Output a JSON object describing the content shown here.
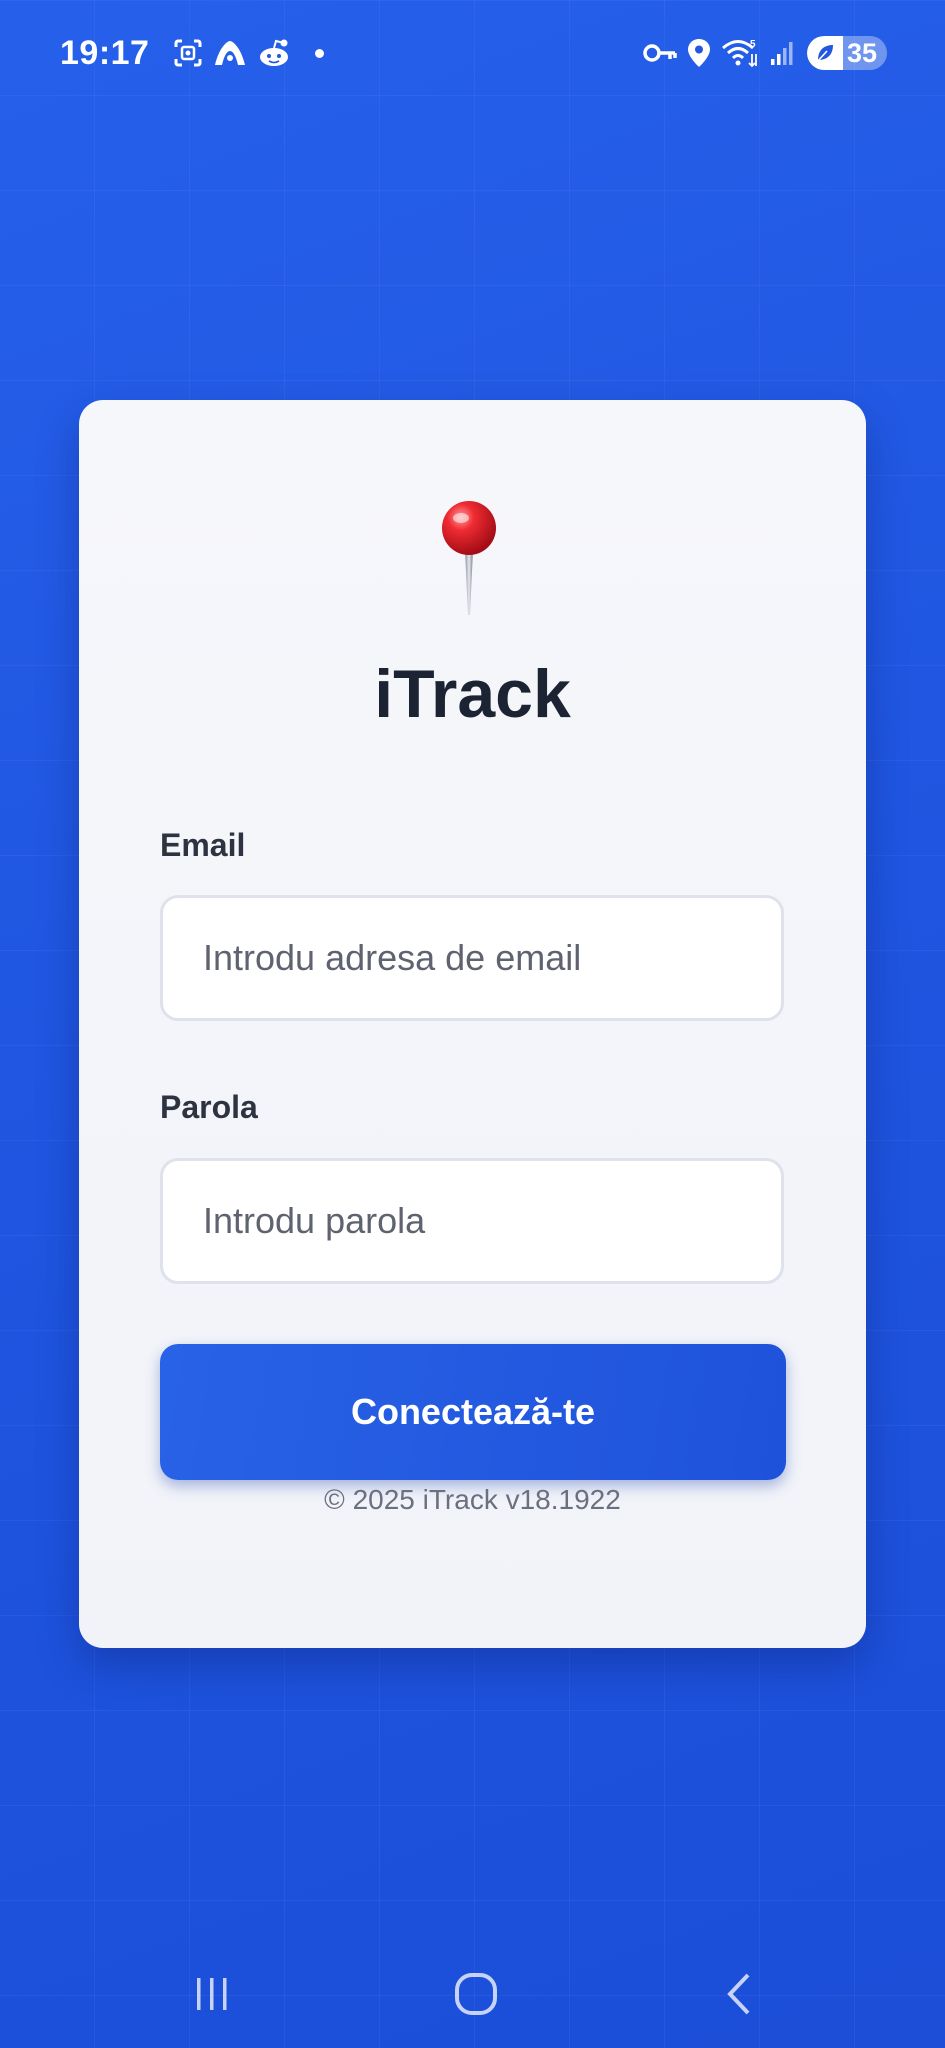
{
  "status_bar": {
    "time": "19:17",
    "battery_level": "35",
    "left_icons": [
      "screenshot-icon",
      "bird-app-icon",
      "reddit-icon",
      "notification-dot"
    ],
    "right_icons": [
      "vpn-key-icon",
      "location-icon",
      "wifi-icon",
      "signal-icon",
      "battery-icon"
    ]
  },
  "login": {
    "logo_icon": "pushpin-icon",
    "title": "iTrack",
    "email_label": "Email",
    "email_placeholder": "Introdu adresa de email",
    "email_value": "",
    "password_label": "Parola",
    "password_placeholder": "Introdu parola",
    "password_value": "",
    "submit_label": "Conectează-te",
    "footer": "© 2025 iTrack v18.1922"
  },
  "navigation": {
    "buttons": [
      "recent-apps",
      "home",
      "back"
    ]
  },
  "colors": {
    "background": "#2257e0",
    "card": "#f4f5fa",
    "button": "#2459e2",
    "title_text": "#1c2434",
    "pin_red": "#e8232b"
  }
}
